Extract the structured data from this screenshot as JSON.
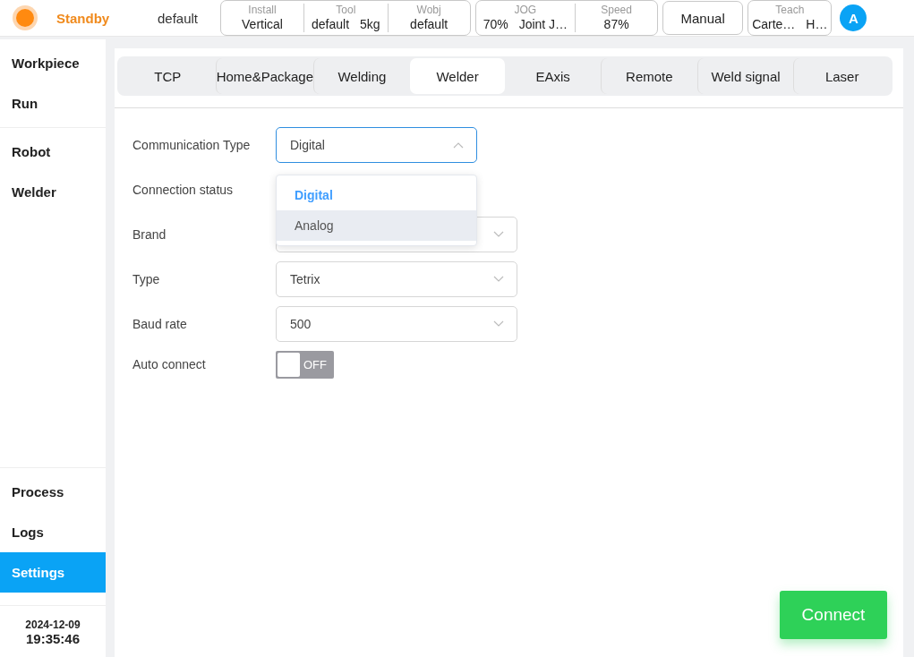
{
  "header": {
    "status": "Standby",
    "project": "default",
    "groups": [
      {
        "kind": "group",
        "cells": [
          {
            "label": "Install",
            "values": [
              "Vertical"
            ]
          },
          {
            "label": "Tool",
            "values": [
              "default",
              "5kg"
            ]
          },
          {
            "label": "Wobj",
            "values": [
              "default"
            ]
          }
        ]
      },
      {
        "kind": "group",
        "cells": [
          {
            "label": "JOG",
            "values": [
              "70%",
              "Joint J…"
            ]
          },
          {
            "label": "Speed",
            "values": [
              "87%"
            ]
          }
        ]
      },
      {
        "kind": "button",
        "label": "Manual"
      },
      {
        "kind": "group",
        "cells": [
          {
            "label": "Teach",
            "values": [
              "Carte…",
              "H…"
            ]
          }
        ]
      }
    ],
    "avatar": "A"
  },
  "sidebar": {
    "top": [
      {
        "label": "Workpiece",
        "selected": false
      },
      {
        "label": "Run",
        "selected": false
      }
    ],
    "middle": [
      {
        "label": "Robot",
        "selected": false
      },
      {
        "label": "Welder",
        "selected": false
      }
    ],
    "bottom": [
      {
        "label": "Process",
        "selected": false
      },
      {
        "label": "Logs",
        "selected": false
      },
      {
        "label": "Settings",
        "selected": true
      }
    ],
    "date": "2024-12-09",
    "time": "19:35:46"
  },
  "tabs": [
    {
      "label": "TCP",
      "selected": false
    },
    {
      "label": "Home&Package",
      "selected": false
    },
    {
      "label": "Welding",
      "selected": false
    },
    {
      "label": "Welder",
      "selected": true
    },
    {
      "label": "EAxis",
      "selected": false
    },
    {
      "label": "Remote",
      "selected": false
    },
    {
      "label": "Weld signal",
      "selected": false
    },
    {
      "label": "Laser",
      "selected": false
    }
  ],
  "form": [
    {
      "kind": "select",
      "label": "Communication Type",
      "value": "Digital",
      "expanded": true
    },
    {
      "kind": "text",
      "label": "Connection status"
    },
    {
      "kind": "select",
      "label": "Brand",
      "expanded": false
    },
    {
      "kind": "select",
      "label": "Type",
      "value": "Tetrix",
      "expanded": false
    },
    {
      "kind": "select",
      "label": "Baud rate",
      "value": "500",
      "expanded": false
    },
    {
      "kind": "toggle",
      "label": "Auto connect",
      "on": false,
      "state_text": "OFF"
    }
  ],
  "dropdown": [
    {
      "label": "Digital",
      "selected": true,
      "hovered": false
    },
    {
      "label": "Analog",
      "selected": false,
      "hovered": true
    }
  ],
  "connect_button": "Connect"
}
